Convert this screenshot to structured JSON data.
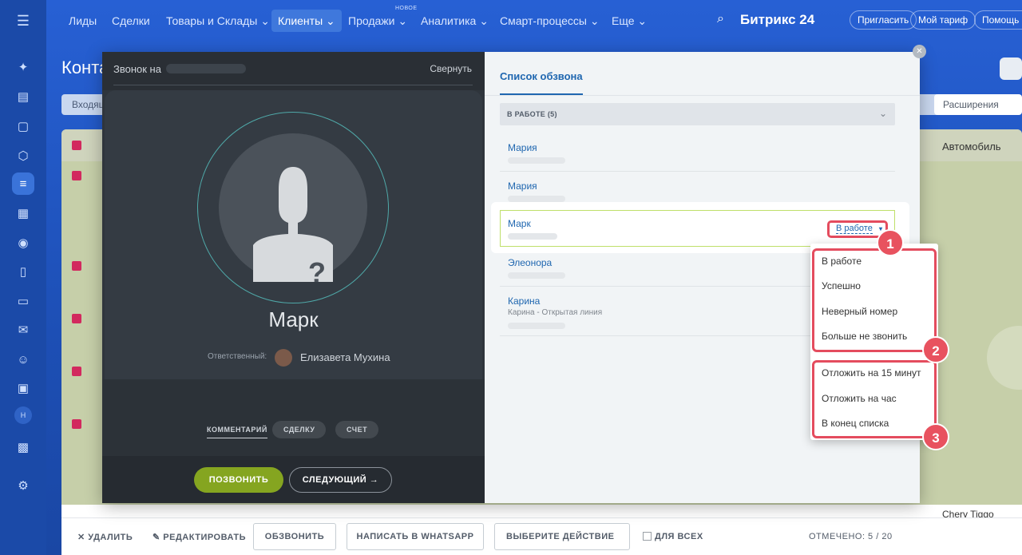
{
  "nav": {
    "items": [
      "Лиды",
      "Сделки",
      "Товары и Склады",
      "Клиенты",
      "Продажи",
      "Аналитика",
      "Смарт-процессы",
      "Еще"
    ],
    "new_badge": "НОВОЕ",
    "logo": "Битрикс 24",
    "invite": "Пригласить",
    "tariff": "Мой тариф",
    "help": "Помощь"
  },
  "page": {
    "title": "Конта",
    "filter_first": "Входящ",
    "extensions": "Расширения",
    "column_auto": "Автомобиль",
    "row_car": "Chery Tiggo"
  },
  "sidebar": {
    "avatar_letter": "Н"
  },
  "call": {
    "top_label": "Звонок на",
    "collapse": "Свернуть",
    "caller_name": "Марк",
    "responsible_label": "Ответственный:",
    "responsible_name": "Елизавета Мухина",
    "tabs": [
      "КОММЕНТАРИЙ",
      "СДЕЛКУ",
      "СЧЕТ"
    ],
    "call_button": "ПОЗВОНИТЬ",
    "next_button": "СЛЕДУЮЩИЙ →"
  },
  "list": {
    "tab": "Список обзвона",
    "group_title": "В РАБОТЕ (5)",
    "contacts": [
      {
        "name": "Мария",
        "sub": ""
      },
      {
        "name": "Мария",
        "sub": ""
      },
      {
        "name": "Марк",
        "sub": ""
      },
      {
        "name": "Элеонора",
        "sub": ""
      },
      {
        "name": "Карина",
        "sub": "Карина - Открытая линия"
      }
    ],
    "status_label": "В работе"
  },
  "status_menu": {
    "group1": [
      "В работе",
      "Успешно",
      "Неверный номер",
      "Больше не звонить"
    ],
    "group2": [
      "Отложить на 15 минут",
      "Отложить на час",
      "В конец списка"
    ]
  },
  "badges": [
    "1",
    "2",
    "3"
  ],
  "actionbar": {
    "delete": "УДАЛИТЬ",
    "edit": "РЕДАКТИРОВАТЬ",
    "call_out": "ОБЗВОНИТЬ",
    "whatsapp": "НАПИСАТЬ В WHATSAPP",
    "choose_action": "ВЫБЕРИТЕ ДЕЙСТВИЕ",
    "for_all": "ДЛЯ ВСЕХ",
    "selected": "ОТМЕЧЕНО: 5 / 20"
  },
  "colors": {
    "accent": "#2067b0",
    "call_green": "#85a520",
    "highlight_red": "#e44c5e"
  }
}
